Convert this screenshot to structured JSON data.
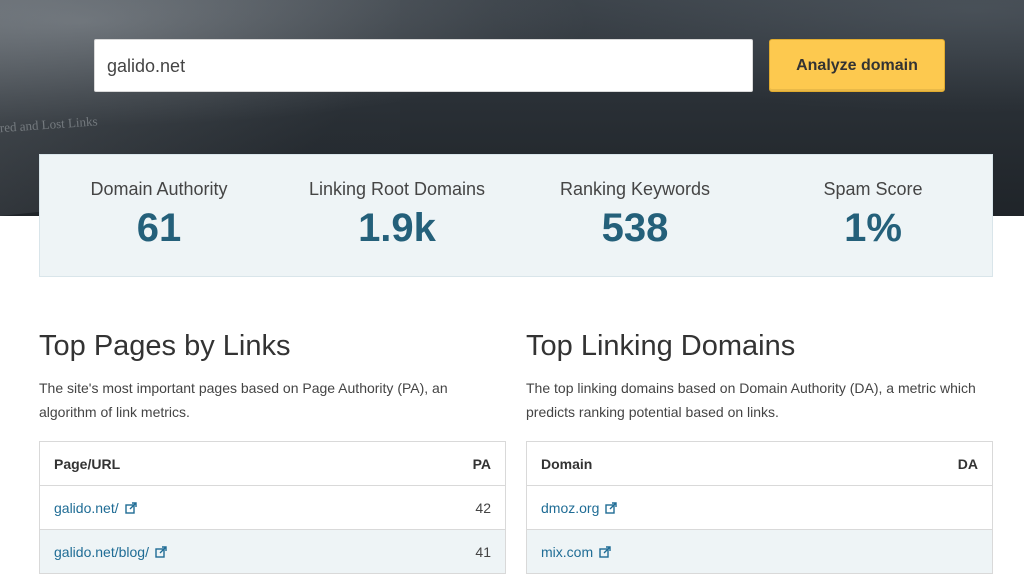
{
  "search": {
    "value": "galido.net"
  },
  "analyze_label": "Analyze domain",
  "hero_ghost": [
    "ered and Lost Links"
  ],
  "metrics": [
    {
      "label": "Domain Authority",
      "value": "61"
    },
    {
      "label": "Linking Root Domains",
      "value": "1.9k"
    },
    {
      "label": "Ranking Keywords",
      "value": "538"
    },
    {
      "label": "Spam Score",
      "value": "1%"
    }
  ],
  "top_pages": {
    "title": "Top Pages by Links",
    "description": "The site's most important pages based on Page Authority (PA), an algorithm of link metrics.",
    "columns": [
      "Page/URL",
      "PA"
    ],
    "rows": [
      {
        "url": "galido.net/",
        "pa": "42"
      },
      {
        "url": "galido.net/blog/",
        "pa": "41"
      }
    ]
  },
  "top_domains": {
    "title": "Top Linking Domains",
    "description": "The top linking domains based on Domain Authority (DA), a metric which predicts ranking potential based on links.",
    "columns": [
      "Domain",
      "DA"
    ],
    "rows": [
      {
        "domain": "dmoz.org",
        "da": ""
      },
      {
        "domain": "mix.com",
        "da": ""
      }
    ]
  },
  "colors": {
    "accent_button": "#fdc94f",
    "metric_value": "#24607a",
    "link": "#1f6c95",
    "panel_bg": "#eef4f6"
  },
  "icons": {
    "external": "external-link-icon"
  }
}
